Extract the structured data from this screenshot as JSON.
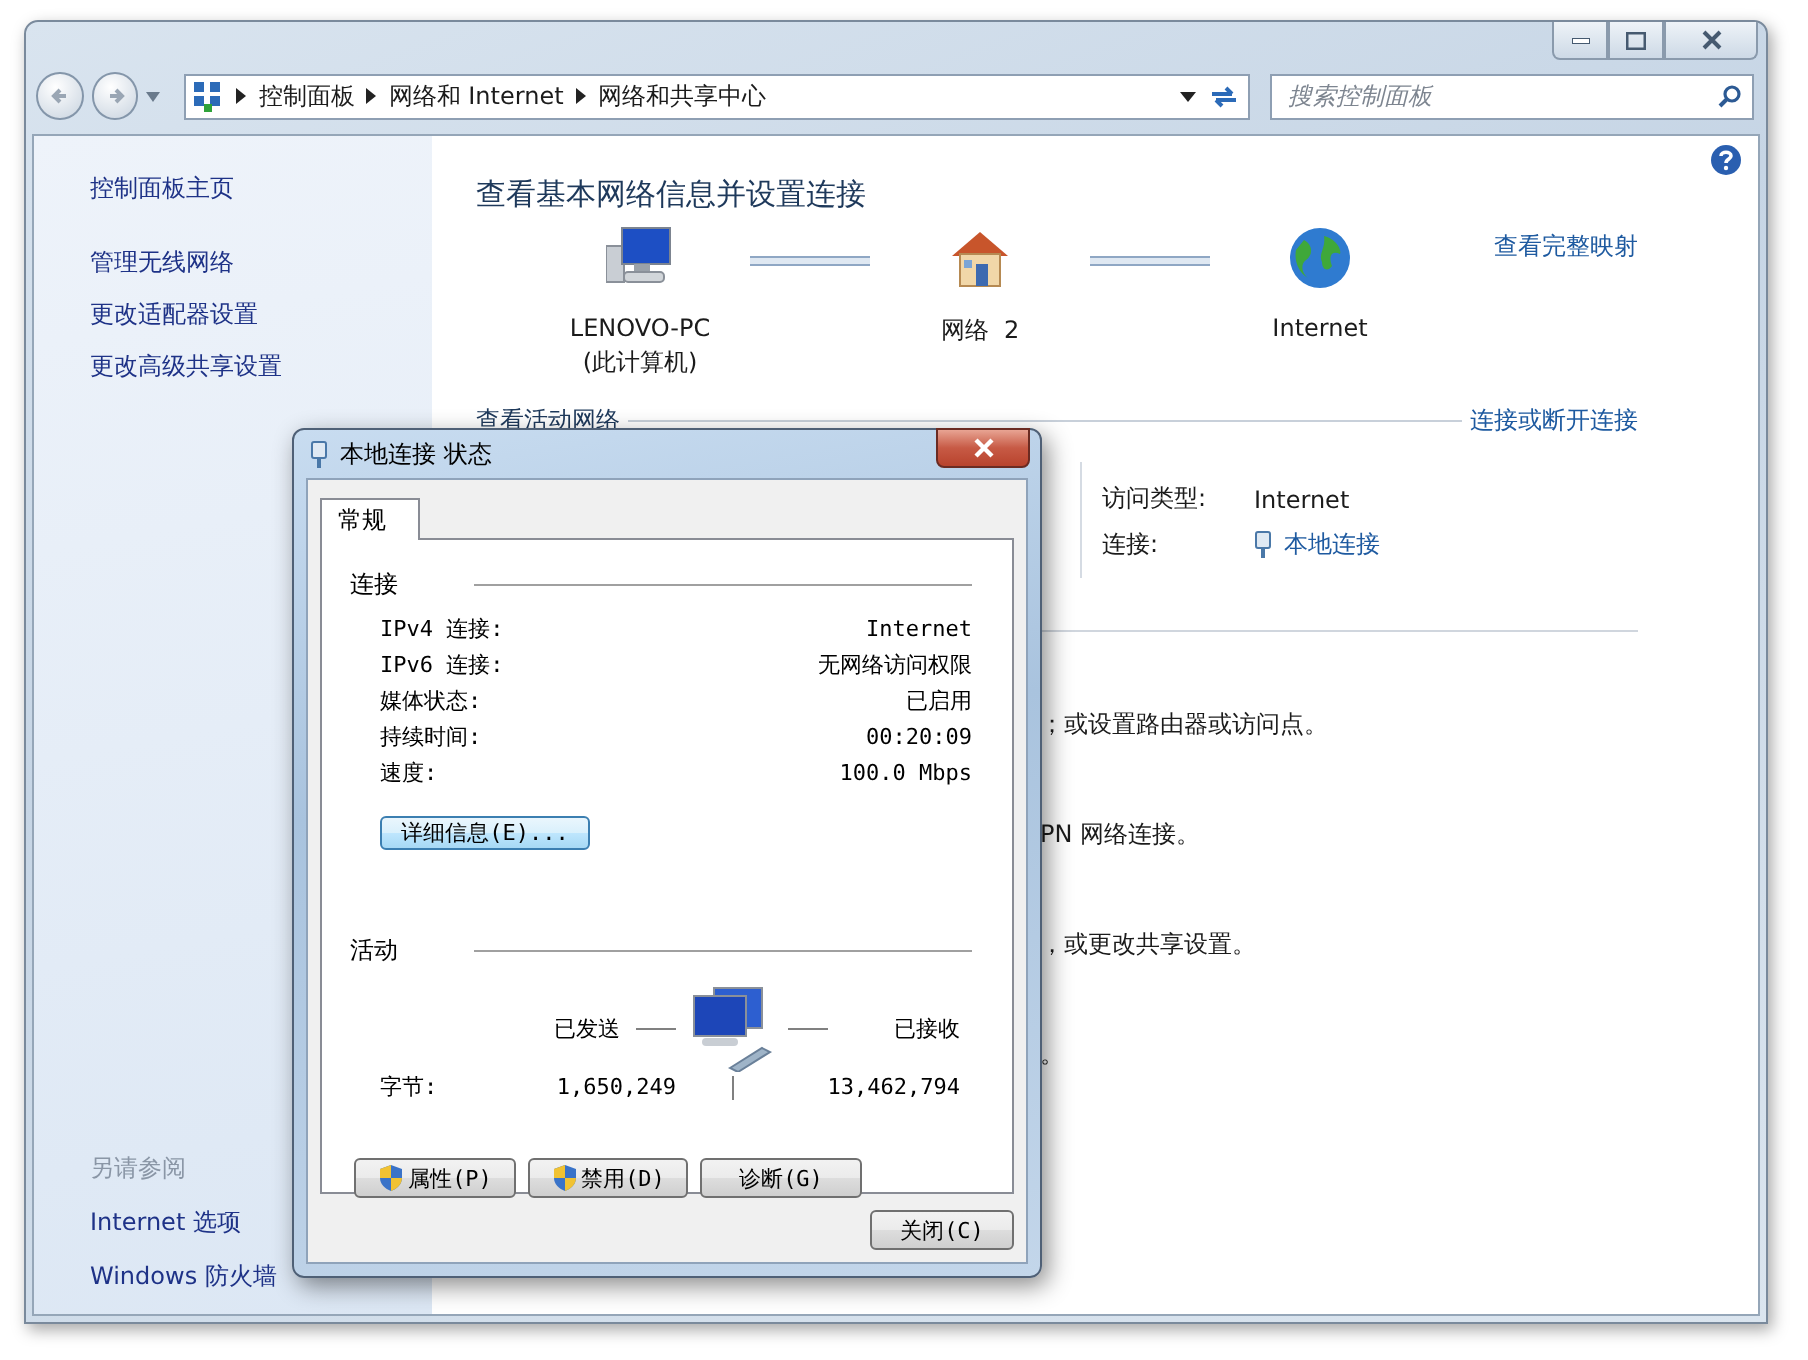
{
  "address_bar": {
    "crumbs": [
      "控制面板",
      "网络和 Internet",
      "网络和共享中心"
    ]
  },
  "search": {
    "placeholder": "搜索控制面板"
  },
  "sidebar": {
    "items": [
      "控制面板主页",
      "管理无线网络",
      "更改适配器设置",
      "更改高级共享设置"
    ],
    "see_also_title": "另请参阅",
    "see_also": [
      "Internet 选项",
      "Windows 防火墙"
    ]
  },
  "main": {
    "title": "查看基本网络信息并设置连接",
    "map_nodes": [
      {
        "kind": "computer",
        "label": "LENOVO-PC",
        "sublabel": "(此计算机)"
      },
      {
        "kind": "house",
        "label": "网络  2"
      },
      {
        "kind": "globe",
        "label": "Internet"
      }
    ],
    "map_link": "查看完整映射",
    "active_heading": "查看活动网络",
    "connect_link": "连接或断开连接",
    "access": [
      {
        "kind": "text",
        "label": "访问类型:",
        "value": "Internet"
      },
      {
        "kind": "link",
        "label": "连接:",
        "value": "本地连接"
      }
    ],
    "tasks": [
      "；或设置路由器或访问点。",
      "PN 网络连接。",
      "，或更改共享设置。",
      "。"
    ]
  },
  "dialog": {
    "title": "本地连接 状态",
    "tabs": [
      {
        "label": "常规",
        "selected": true
      }
    ],
    "connection_title": "连接",
    "rows": [
      {
        "label": "IPv4 连接:",
        "value": "Internet"
      },
      {
        "label": "IPv6 连接:",
        "value": "无网络访问权限"
      },
      {
        "label": "媒体状态:",
        "value": "已启用"
      },
      {
        "label": "持续时间:",
        "value": "00:20:09"
      },
      {
        "label": "速度:",
        "value": "100.0 Mbps"
      }
    ],
    "details_button": "详细信息(E)...",
    "activity_title": "活动",
    "sent_label": "已发送",
    "received_label": "已接收",
    "bytes_label": "字节:",
    "bytes_sent": "1,650,249",
    "bytes_received": "13,462,794",
    "buttons": [
      {
        "label": "属性(P)",
        "shield": true
      },
      {
        "label": "禁用(D)",
        "shield": true
      },
      {
        "label": "诊断(G)",
        "shield": false
      }
    ],
    "close_button": "关闭(C)"
  }
}
